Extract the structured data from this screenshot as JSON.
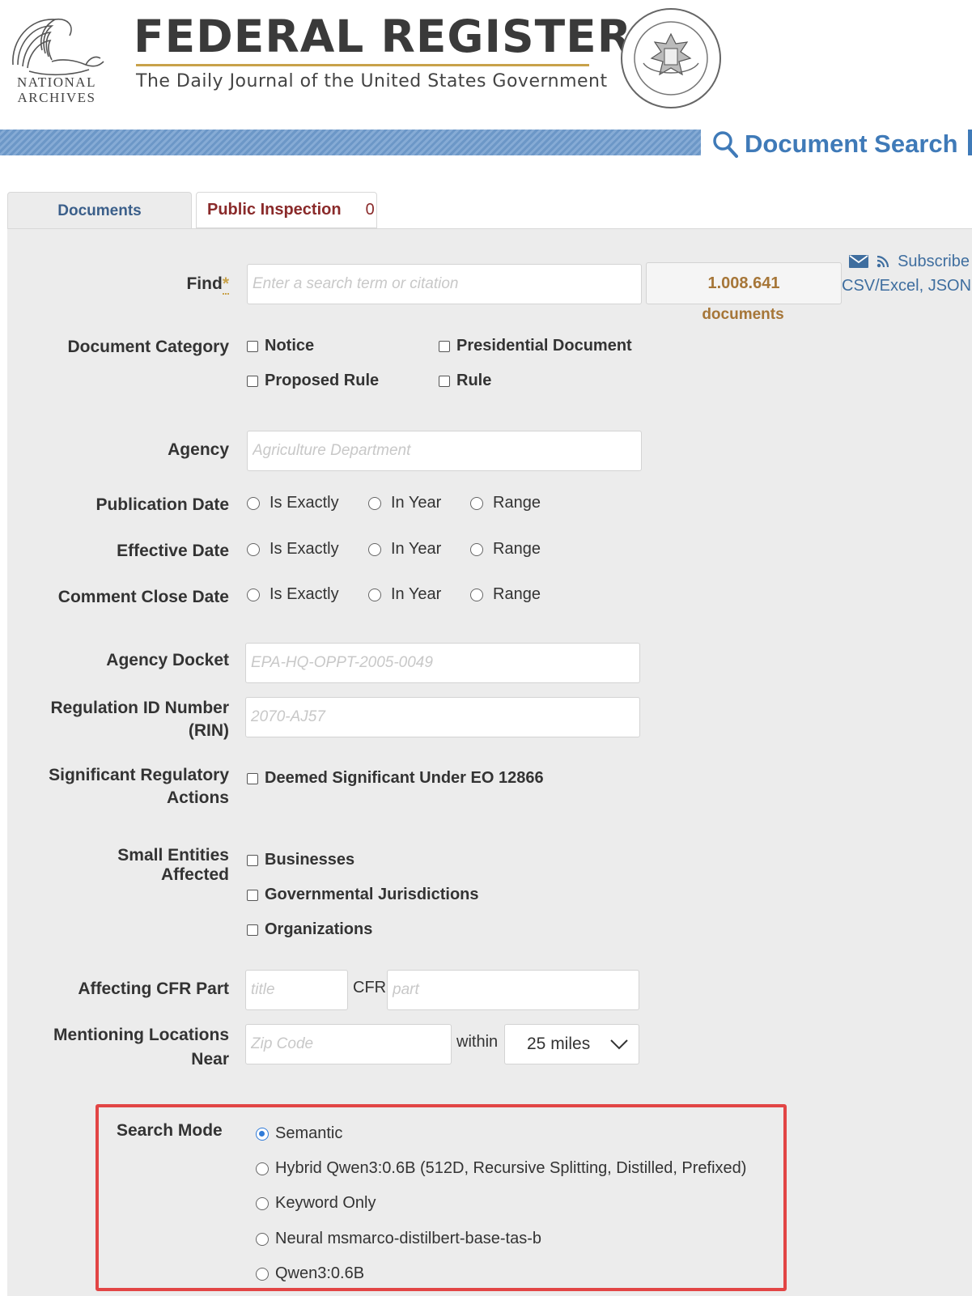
{
  "header": {
    "logo_text_line1": "NATIONAL",
    "logo_text_line2": "ARCHIVES",
    "title": "FEDERAL REGISTER",
    "subtitle": "The Daily Journal of the United States Government",
    "search_heading": "Document Search"
  },
  "tabs": {
    "documents": "Documents",
    "public_inspection": "Public Inspection",
    "public_inspection_count": "0"
  },
  "find": {
    "label": "Find",
    "required_mark": "*",
    "placeholder": "Enter a search term or citation",
    "result_count": "1.008.641",
    "result_label": "documents"
  },
  "links": {
    "subscribe": "Subscribe",
    "csv": "CSV/Excel, JSON"
  },
  "document_category": {
    "label": "Document Category",
    "options": [
      "Notice",
      "Presidential Document",
      "Proposed Rule",
      "Rule"
    ]
  },
  "agency": {
    "label": "Agency",
    "placeholder": "Agriculture Department"
  },
  "date_options": [
    "Is Exactly",
    "In Year",
    "Range"
  ],
  "publication_date": {
    "label": "Publication Date"
  },
  "effective_date": {
    "label": "Effective Date"
  },
  "comment_close_date": {
    "label": "Comment Close Date"
  },
  "agency_docket": {
    "label": "Agency Docket",
    "placeholder": "EPA-HQ-OPPT-2005-0049"
  },
  "rin": {
    "label_line1": "Regulation ID Number",
    "label_line2": "(RIN)",
    "placeholder": "2070-AJ57"
  },
  "significant": {
    "label_line1": "Significant Regulatory",
    "label_line2": "Actions",
    "option": "Deemed Significant Under EO 12866"
  },
  "small_entities": {
    "label_line1": "Small Entities",
    "label_line2": "Affected",
    "options": [
      "Businesses",
      "Governmental Jurisdictions",
      "Organizations"
    ]
  },
  "cfr": {
    "label": "Affecting CFR Part",
    "title_placeholder": "title",
    "middle": "CFR",
    "part_placeholder": "part"
  },
  "locations": {
    "label_line1": "Mentioning Locations",
    "label_line2": "Near",
    "zip_placeholder": "Zip Code",
    "within": "within",
    "distance": "25 miles"
  },
  "search_mode": {
    "label": "Search Mode",
    "selected": "Semantic",
    "options": [
      "Semantic",
      "Hybrid Qwen3:0.6B (512D, Recursive Splitting, Distilled, Prefixed)",
      "Keyword Only",
      "Neural msmarco-distilbert-base-tas-b",
      "Qwen3:0.6B"
    ]
  },
  "colors": {
    "accent_blue": "#3f7ab8",
    "tab_red": "#8a2a2a",
    "count_gold": "#a67638",
    "highlight_red": "#e24545"
  }
}
